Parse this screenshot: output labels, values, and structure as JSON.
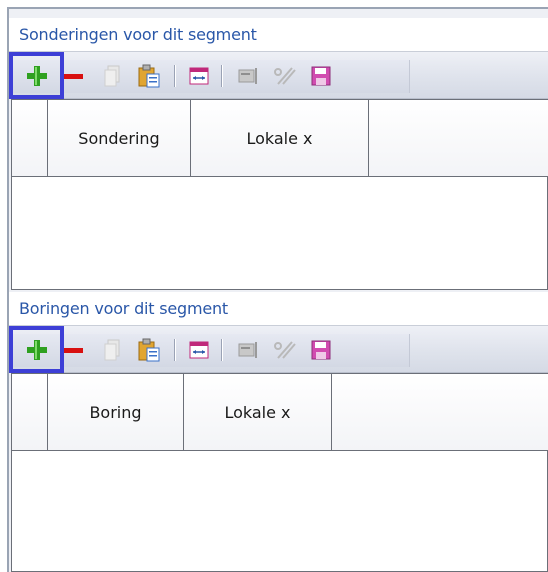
{
  "panels": [
    {
      "title": "Sonderingen voor dit segment",
      "columns": [
        "",
        "Sondering",
        "Lokale x",
        ""
      ]
    },
    {
      "title": "Boringen voor dit segment",
      "columns": [
        "",
        "Boring",
        "Lokale x",
        ""
      ]
    }
  ],
  "toolbar_icons": [
    "add-icon",
    "remove-icon",
    "copy-icon",
    "paste-icon",
    "insert-range-icon",
    "edit-icon",
    "cut-icon",
    "save-icon"
  ],
  "colors": {
    "header_text": "#2a57a8",
    "highlight": "#3d3fd6",
    "add": "#2fa020",
    "remove": "#d81010"
  }
}
